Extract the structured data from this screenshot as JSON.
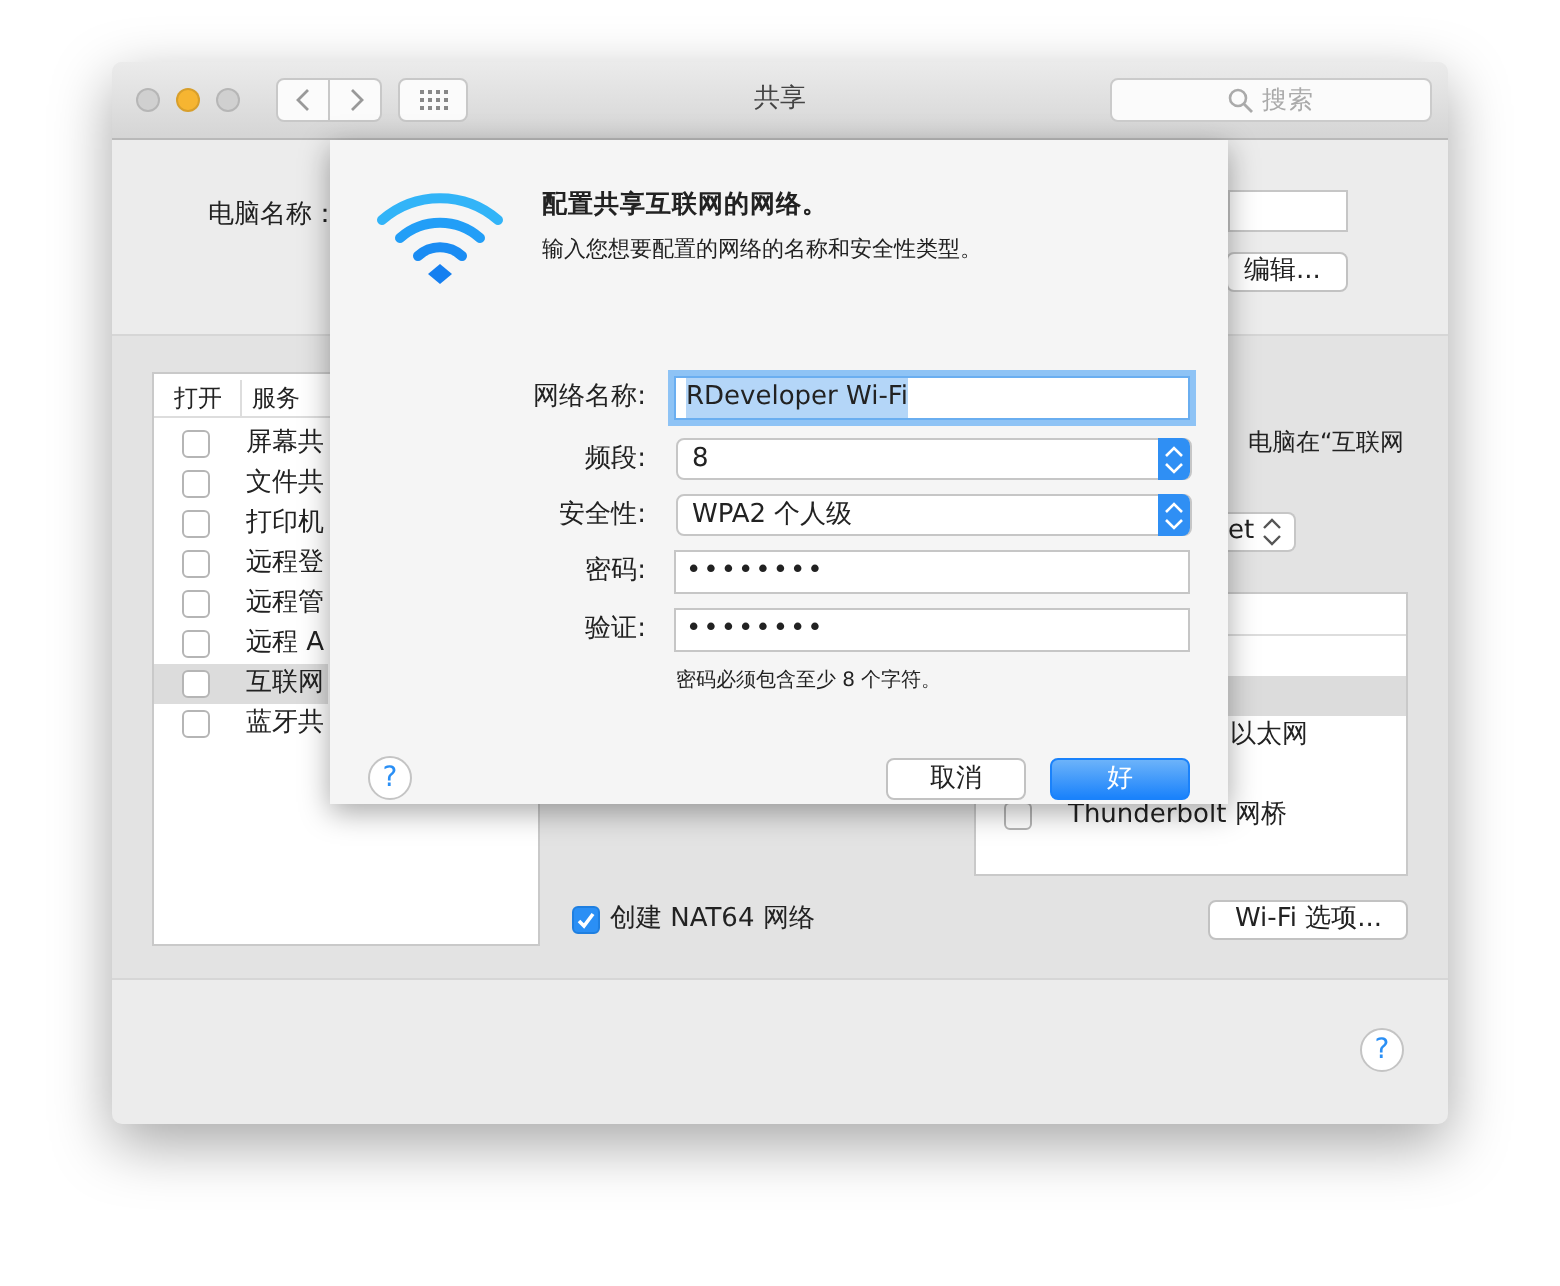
{
  "window": {
    "title": "共享",
    "search": {
      "placeholder": "搜索"
    }
  },
  "computer_name": {
    "label": "电脑名称：",
    "edit_button": "编辑..."
  },
  "services": {
    "columns": [
      "打开",
      "服务"
    ],
    "rows": [
      {
        "label": "屏幕共",
        "checked": false,
        "selected": false
      },
      {
        "label": "文件共",
        "checked": false,
        "selected": false
      },
      {
        "label": "打印机",
        "checked": false,
        "selected": false
      },
      {
        "label": "远程登",
        "checked": false,
        "selected": false
      },
      {
        "label": "远程管",
        "checked": false,
        "selected": false
      },
      {
        "label": "远程 A",
        "checked": false,
        "selected": false
      },
      {
        "label": "互联网",
        "checked": false,
        "selected": true
      },
      {
        "label": "蓝牙共",
        "checked": false,
        "selected": false
      }
    ]
  },
  "detail": {
    "hint": "电脑在“互联网",
    "popup_value": "et",
    "ports": [
      {
        "selected": false
      },
      {
        "selected": false
      },
      {
        "selected": true
      },
      {
        "label": "以太网",
        "selected": false
      },
      {
        "selected": false
      },
      {
        "label": "Thunderbolt 网桥",
        "checked": false,
        "selected": false
      }
    ],
    "nat64": {
      "label": "创建 NAT64 网络",
      "checked": true
    },
    "wifi_options_button": "Wi-Fi 选项...",
    "help_button": "?"
  },
  "sheet": {
    "title": "配置共享互联网的网络。",
    "subtitle": "输入您想要配置的网络的名称和安全性类型。",
    "fields": [
      {
        "kind": "text",
        "label": "网络名称:",
        "value": "RDeveloper Wi-Fi",
        "focused": true
      },
      {
        "kind": "popup",
        "label": "频段:",
        "value": "8"
      },
      {
        "kind": "popup",
        "label": "安全性:",
        "value": "WPA2 个人级"
      },
      {
        "kind": "password",
        "label": "密码:",
        "value": "••••••••"
      },
      {
        "kind": "password",
        "label": "验证:",
        "value": "••••••••"
      }
    ],
    "hint": "密码必须包含至少 8 个字符。",
    "help_button": "?",
    "buttons": [
      {
        "label": "取消",
        "default": false
      },
      {
        "label": "好",
        "default": true
      }
    ]
  }
}
